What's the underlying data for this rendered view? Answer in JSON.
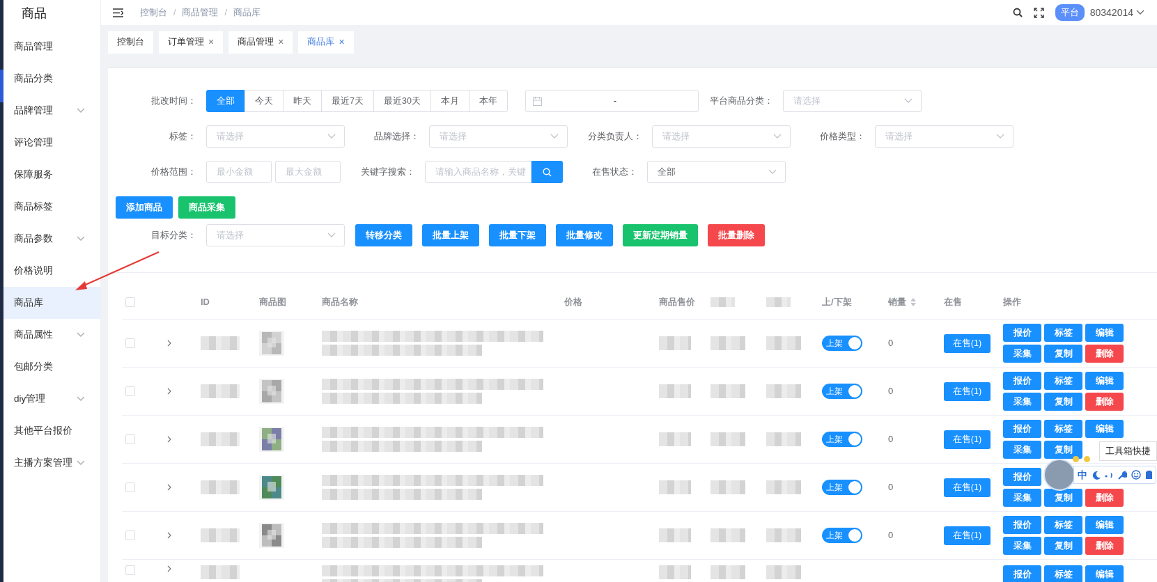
{
  "sidebar": {
    "title": "商品",
    "items": [
      {
        "label": "商品管理",
        "expandable": false,
        "selected": false
      },
      {
        "label": "商品分类",
        "expandable": false,
        "selected": false
      },
      {
        "label": "品牌管理",
        "expandable": true,
        "selected": false
      },
      {
        "label": "评论管理",
        "expandable": false,
        "selected": false
      },
      {
        "label": "保障服务",
        "expandable": false,
        "selected": false
      },
      {
        "label": "商品标签",
        "expandable": false,
        "selected": false
      },
      {
        "label": "商品参数",
        "expandable": true,
        "selected": false
      },
      {
        "label": "价格说明",
        "expandable": false,
        "selected": false
      },
      {
        "label": "商品库",
        "expandable": false,
        "selected": true
      },
      {
        "label": "商品属性",
        "expandable": true,
        "selected": false
      },
      {
        "label": "包邮分类",
        "expandable": false,
        "selected": false
      },
      {
        "label": "diy管理",
        "expandable": true,
        "selected": false
      },
      {
        "label": "其他平台报价",
        "expandable": false,
        "selected": false
      },
      {
        "label": "主播方案管理",
        "expandable": true,
        "selected": false
      }
    ]
  },
  "topbar": {
    "breadcrumb": [
      "控制台",
      "商品管理",
      "商品库"
    ],
    "separator": "/",
    "role_badge": "平台",
    "user": "80342014"
  },
  "tabs": [
    {
      "label": "控制台",
      "selected": false
    },
    {
      "label": "订单管理",
      "close": "×",
      "selected": false
    },
    {
      "label": "商品管理",
      "close": "×",
      "selected": false
    },
    {
      "label": "商品库",
      "close": "×",
      "selected": true
    }
  ],
  "filter_rows": [
    [
      {
        "kind": "segment",
        "label": "批改时间：",
        "options": [
          {
            "label": "全部",
            "selected": true
          },
          {
            "label": "今天",
            "selected": false
          },
          {
            "label": "昨天",
            "selected": false
          },
          {
            "label": "最近7天",
            "selected": false
          },
          {
            "label": "最近30天",
            "selected": false
          },
          {
            "label": "本月",
            "selected": false
          },
          {
            "label": "本年",
            "selected": false
          }
        ]
      },
      {
        "kind": "daterange",
        "separator": "-"
      },
      {
        "kind": "select",
        "label": "平台商品分类：",
        "placeholder": "请选择"
      }
    ],
    [
      {
        "kind": "select",
        "label": "标签：",
        "placeholder": "请选择"
      },
      {
        "kind": "select",
        "label": "品牌选择：",
        "placeholder": "请选择"
      },
      {
        "kind": "select",
        "label": "分类负责人：",
        "placeholder": "请选择"
      },
      {
        "kind": "select",
        "label": "价格类型：",
        "placeholder": "请选择"
      }
    ],
    [
      {
        "kind": "range",
        "label": "价格范围：",
        "placeholders": [
          "最小金额",
          "最大金额"
        ]
      },
      {
        "kind": "search",
        "label": "关键字搜索：",
        "placeholder": "请输入商品名称，关键"
      },
      {
        "kind": "select",
        "label": "在售状态：",
        "value": "全部"
      }
    ]
  ],
  "actions": [
    {
      "label": "添加商品",
      "kind": "primary"
    },
    {
      "label": "商品采集",
      "kind": "success"
    }
  ],
  "batch": {
    "label": "目标分类：",
    "placeholder": "请选择",
    "buttons": [
      {
        "label": "转移分类",
        "kind": "primary"
      },
      {
        "label": "批量上架",
        "kind": "primary"
      },
      {
        "label": "批量下架",
        "kind": "primary"
      },
      {
        "label": "批量修改",
        "kind": "primary"
      },
      {
        "label": "更新定期销量",
        "kind": "success"
      },
      {
        "label": "批量删除",
        "kind": "danger"
      }
    ]
  },
  "table": {
    "all_checked": false,
    "columns": [
      {
        "kind": "checkbox"
      },
      {
        "kind": "blank"
      },
      {
        "kind": "text",
        "label": "ID"
      },
      {
        "kind": "text",
        "label": "商品图"
      },
      {
        "kind": "text",
        "label": "商品名称"
      },
      {
        "kind": "text",
        "label": "价格"
      },
      {
        "kind": "text",
        "label": "商品售价"
      },
      {
        "kind": "pixelated"
      },
      {
        "kind": "pixelated"
      },
      {
        "kind": "text",
        "label": "上/下架"
      },
      {
        "kind": "text",
        "label": "销量",
        "sortable": true
      },
      {
        "kind": "text",
        "label": "在售"
      },
      {
        "kind": "text",
        "label": "操作"
      }
    ],
    "rows": [
      {
        "checked": false,
        "image": {
          "kind": "picture"
        },
        "listed": true,
        "listed_label": "上架",
        "sales": "0",
        "on_sale": "在售(1)",
        "actions": [
          {
            "label": "报价",
            "kind": "primary"
          },
          {
            "label": "标签",
            "kind": "primary"
          },
          {
            "label": "编辑",
            "kind": "primary"
          },
          {
            "label": "采集",
            "kind": "primary"
          },
          {
            "label": "复制",
            "kind": "primary"
          },
          {
            "label": "删除",
            "kind": "danger"
          }
        ]
      },
      {
        "checked": false,
        "image": {
          "kind": "picture"
        },
        "listed": true,
        "listed_label": "上架",
        "sales": "0",
        "on_sale": "在售(1)",
        "actions": [
          {
            "label": "报价",
            "kind": "primary"
          },
          {
            "label": "标签",
            "kind": "primary"
          },
          {
            "label": "编辑",
            "kind": "primary"
          },
          {
            "label": "采集",
            "kind": "primary"
          },
          {
            "label": "复制",
            "kind": "primary"
          },
          {
            "label": "删除",
            "kind": "danger"
          }
        ]
      },
      {
        "checked": false,
        "image": {
          "kind": "picture"
        },
        "listed": true,
        "listed_label": "上架",
        "sales": "0",
        "on_sale": "在售(1)",
        "actions": [
          {
            "label": "报价",
            "kind": "primary"
          },
          {
            "label": "标签",
            "kind": "primary"
          },
          {
            "label": "编辑",
            "kind": "primary"
          },
          {
            "label": "采集",
            "kind": "primary"
          },
          {
            "label": "复制",
            "kind": "primary"
          },
          {
            "kind": "covered"
          }
        ]
      },
      {
        "checked": false,
        "image": {
          "kind": "picture"
        },
        "listed": true,
        "listed_label": "上架",
        "sales": "0",
        "on_sale": "在售(1)",
        "actions": [
          {
            "label": "报价",
            "kind": "primary"
          },
          {
            "kind": "covered"
          },
          {
            "kind": "covered"
          },
          {
            "label": "采集",
            "kind": "primary"
          },
          {
            "label": "复制",
            "kind": "primary"
          },
          {
            "label": "删除",
            "kind": "danger"
          }
        ]
      },
      {
        "checked": false,
        "image": {
          "kind": "picture"
        },
        "listed": true,
        "listed_label": "上架",
        "sales": "0",
        "on_sale": "在售(1)",
        "actions": [
          {
            "label": "报价",
            "kind": "primary"
          },
          {
            "label": "标签",
            "kind": "primary"
          },
          {
            "label": "编辑",
            "kind": "primary"
          },
          {
            "label": "采集",
            "kind": "primary"
          },
          {
            "label": "复制",
            "kind": "primary"
          },
          {
            "label": "删除",
            "kind": "danger"
          }
        ]
      },
      {
        "checked": false,
        "actions": [
          {
            "label": "报价",
            "kind": "primary"
          },
          {
            "label": "标签",
            "kind": "primary"
          },
          {
            "label": "编辑",
            "kind": "primary"
          }
        ]
      }
    ]
  },
  "ime_toolbar": {
    "tooltip": "工具箱快捷",
    "mode": "中"
  }
}
